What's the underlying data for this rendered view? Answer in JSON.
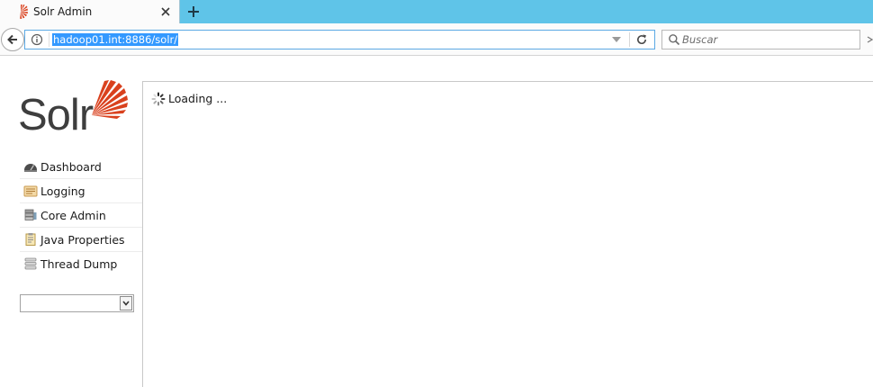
{
  "browser": {
    "tab": {
      "title": "Solr Admin"
    },
    "url": "hadoop01.int:8886/solr/",
    "search_placeholder": "Buscar"
  },
  "colors": {
    "tabstrip": "#5fc4e8",
    "url_selection": "#3399ff",
    "solr_red": "#d9411e",
    "logo_text": "#3e3e3e"
  },
  "sidebar": {
    "logo_text": "Solr",
    "menu": [
      {
        "label": "Dashboard",
        "icon": "dashboard-icon"
      },
      {
        "label": "Logging",
        "icon": "logging-icon"
      },
      {
        "label": "Core Admin",
        "icon": "core-admin-icon"
      },
      {
        "label": "Java Properties",
        "icon": "java-properties-icon"
      },
      {
        "label": "Thread Dump",
        "icon": "thread-dump-icon"
      }
    ],
    "core_selector": {
      "value": ""
    }
  },
  "main": {
    "loading_text": "Loading ..."
  }
}
